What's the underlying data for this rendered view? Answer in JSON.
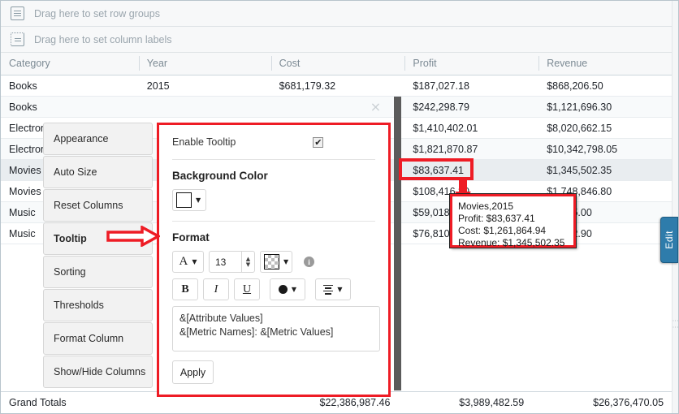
{
  "dropzones": [
    {
      "icon": "row-groups-icon",
      "text": "Drag here to set row groups"
    },
    {
      "icon": "column-labels-icon",
      "text": "Drag here to set column labels"
    }
  ],
  "grid": {
    "columns": [
      "Category",
      "Year",
      "Cost",
      "Profit",
      "Revenue"
    ],
    "rows": [
      {
        "category": "Books",
        "year": "2015",
        "cost": "$681,179.32",
        "profit": "$187,027.18",
        "revenue": "$868,206.50"
      },
      {
        "category": "Books",
        "year": "",
        "cost": "",
        "profit": "$242,298.79",
        "revenue": "$1,121,696.30"
      },
      {
        "category": "Electronics",
        "year": "",
        "cost": "",
        "profit": "$1,410,402.01",
        "revenue": "$8,020,662.15"
      },
      {
        "category": "Electronics",
        "year": "",
        "cost": "",
        "profit": "$1,821,870.87",
        "revenue": "$10,342,798.05"
      },
      {
        "category": "Movies",
        "year": "",
        "cost": "",
        "profit": "$83,637.41",
        "revenue": "$1,345,502.35"
      },
      {
        "category": "Movies",
        "year": "",
        "cost": "",
        "profit": "$108,416.80",
        "revenue": "$1,748,846.80"
      },
      {
        "category": "Music",
        "year": "",
        "cost": "",
        "profit": "$59,018.70",
        "revenue": "$1,235.00"
      },
      {
        "category": "Music",
        "year": "",
        "cost": "",
        "profit": "$76,810.50",
        "revenue": "$1,522.90"
      }
    ],
    "grand_totals": {
      "label": "Grand Totals",
      "cost": "$22,386,987.46",
      "profit": "$3,989,482.59",
      "revenue": "$26,376,470.05"
    }
  },
  "editor": {
    "close_label": "×",
    "menu": [
      "Appearance",
      "Auto Size",
      "Reset Columns",
      "Tooltip",
      "Sorting",
      "Thresholds",
      "Format Column",
      "Show/Hide Columns"
    ],
    "active_menu": "Tooltip",
    "panel": {
      "enable_tooltip_label": "Enable Tooltip",
      "enable_tooltip_checked": "✔",
      "background_color_label": "Background Color",
      "background_color_value": "#ffffff",
      "format_label": "Format",
      "font_button": "A",
      "font_size": "13",
      "font_color_value": "transparent",
      "bold_label": "B",
      "italic_label": "I",
      "underline_label": "U",
      "fill_color_value": "#1a1a1a",
      "template_text": "&[Attribute Values]\n&[Metric Names]: &[Metric Values]",
      "apply_label": "Apply"
    }
  },
  "tooltip_preview": {
    "line1": "Movies,2015",
    "line2": "Profit: $83,637.41",
    "line3": "Cost: $1,261,864.94",
    "line4": "Revenue: $1,345,502.35"
  },
  "edit_tab": {
    "label": "Edit"
  },
  "annotation": {
    "color": "#ee1c25"
  }
}
